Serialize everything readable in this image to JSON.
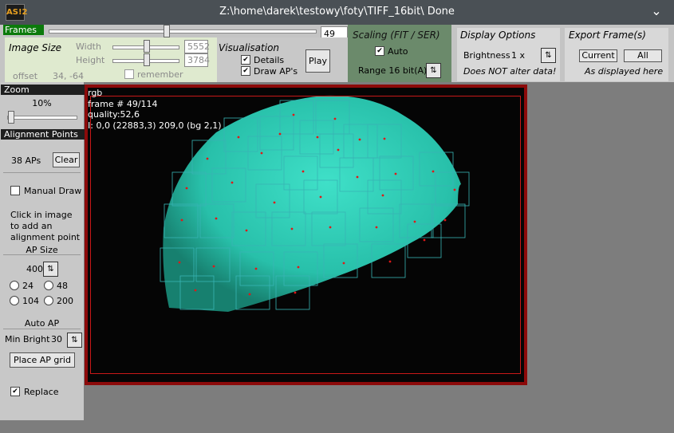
{
  "app": {
    "logo_text": "AS!2",
    "title": "Z:\\home\\darek\\testowy\\foty\\TIFF_16bit\\ Done"
  },
  "frames": {
    "label": "Frames",
    "current": "49",
    "slider_fraction": 0.43
  },
  "image_size": {
    "title": "Image Size",
    "width_label": "Width",
    "width_value": "5552",
    "height_label": "Height",
    "height_value": "3784",
    "remember_label": "remember",
    "remember_checked": false,
    "offset_label": "offset",
    "offset_value": "34, -64"
  },
  "visualisation": {
    "title": "Visualisation",
    "details_label": "Details",
    "details_checked": true,
    "draw_aps_label": "Draw AP's",
    "draw_aps_checked": true,
    "play_label": "Play"
  },
  "scaling": {
    "title": "Scaling (FIT / SER)",
    "auto_label": "Auto",
    "auto_checked": true,
    "range_label": "Range 16 bit(A)"
  },
  "display_options": {
    "title": "Display Options",
    "brightness_label": "Brightness",
    "brightness_value": "1 x",
    "note": "Does NOT alter data!"
  },
  "export": {
    "title": "Export Frame(s)",
    "current_label": "Current",
    "all_label": "All",
    "note": "As displayed here"
  },
  "zoom": {
    "header": "Zoom",
    "value": "10%",
    "slider_fraction": 0.05
  },
  "alignment": {
    "header": "Alignment Points",
    "count": "38 APs",
    "clear_label": "Clear",
    "manual_draw_label": "Manual Draw",
    "manual_draw_checked": false,
    "help_line1": "Click in image",
    "help_line2": "to add an",
    "help_line3": "alignment point",
    "ap_size_label": "AP Size",
    "ap_size_value": "400",
    "options": [
      "24",
      "48",
      "104",
      "200"
    ],
    "auto_ap_label": "Auto AP",
    "min_bright_label": "Min Bright",
    "min_bright_value": "30",
    "place_grid_label": "Place AP grid",
    "replace_label": "Replace",
    "replace_checked": true
  },
  "overlay": {
    "line1": "rgb",
    "line2": "frame # 49/114",
    "line3": "quality:52,6",
    "line4": "I: 0,0 (22883,3) 209,0 (bg 2,1)"
  },
  "colors": {
    "accent_green": "#0b7a0b",
    "moon": "#2fd0b8",
    "viewer_border": "#8c0a0a",
    "ap_box": "#38b4b4",
    "ap_dot": "#e01818"
  }
}
